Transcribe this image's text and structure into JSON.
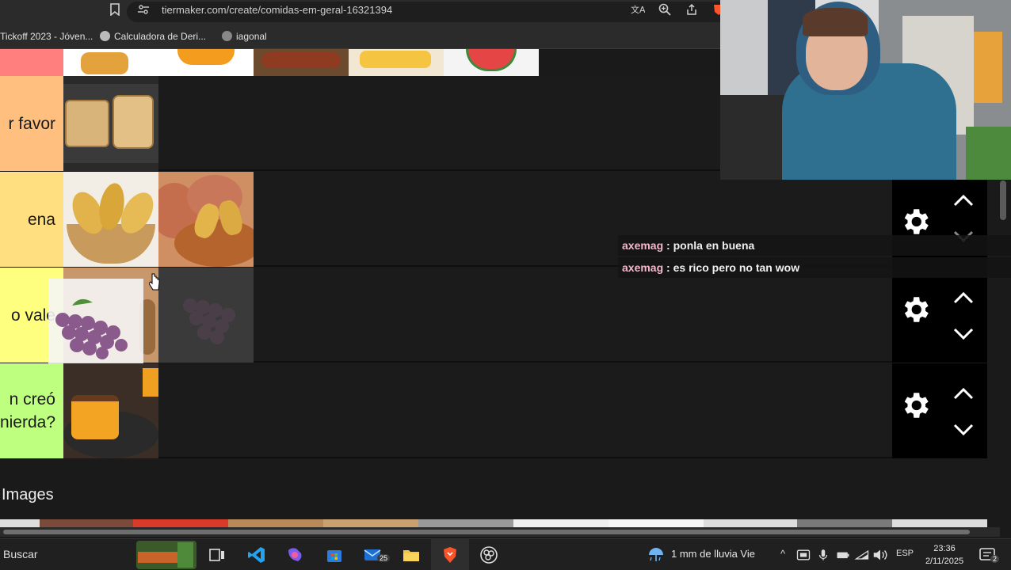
{
  "browser": {
    "url": "tiermaker.com/create/comidas-em-geral-16321394",
    "bookmarks": [
      {
        "label": "Tickoff 2023 - Jóven..."
      },
      {
        "label": "Calculadora de Deri..."
      },
      {
        "label": "iagonal"
      }
    ]
  },
  "tiers": [
    {
      "label": "r favor",
      "color": "#ffbf7f"
    },
    {
      "label": "ena",
      "color": "#ffdf7f"
    },
    {
      "label": "o vale",
      "color": "#ffff7f"
    },
    {
      "label": "n creó\nnierda?",
      "color": "#bfff7f"
    }
  ],
  "images_section": {
    "heading": "Images"
  },
  "chat": [
    {
      "user": "axemag",
      "sep": " : ",
      "message": "ponla en buena"
    },
    {
      "user": "axemag",
      "sep": " : ",
      "message": "es rico pero no tan wow"
    }
  ],
  "taskbar": {
    "search": "Buscar",
    "mail_badge": "25",
    "weather": "1 mm de lluvia Vie",
    "language": "ESP",
    "time": "23:36",
    "date": "2/11/2025",
    "notifications": "2"
  },
  "icons": [
    "bookmark-icon",
    "site-info-icon",
    "translate-icon",
    "zoom-icon",
    "share-icon",
    "gear-icon",
    "chevron-up-icon",
    "chevron-down-icon",
    "task-view-icon",
    "vscode-icon",
    "copilot-icon",
    "store-icon",
    "mail-icon",
    "folder-icon",
    "brave-icon",
    "obs-icon",
    "weather-icon",
    "wifi-icon",
    "volume-icon",
    "mic-icon",
    "notification-icon"
  ]
}
